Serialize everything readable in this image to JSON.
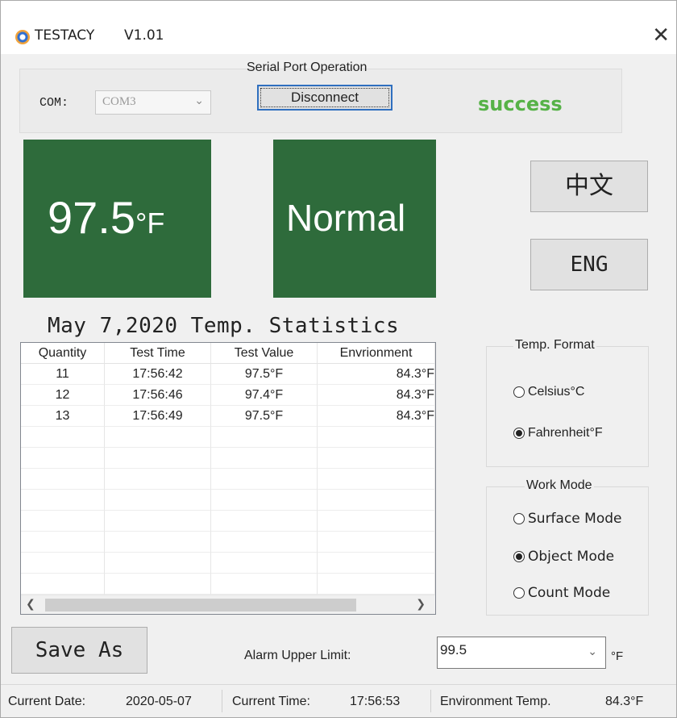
{
  "window": {
    "app_name": "TESTACY",
    "version": "V1.01",
    "close_glyph": "✕"
  },
  "serial": {
    "group_label": "Serial Port Operation",
    "com_label": "COM:",
    "com_value": "COM3",
    "disconnect_label": "Disconnect",
    "status_text": "success"
  },
  "readout": {
    "temperature": "97.5",
    "unit": "°F",
    "status": "Normal"
  },
  "language": {
    "chinese_label": "中文",
    "english_label": "ENG"
  },
  "stats": {
    "title": "May 7,2020 Temp. Statistics",
    "columns": [
      "Quantity",
      "Test Time",
      "Test Value",
      "Envrionment"
    ],
    "rows": [
      [
        "11",
        "17:56:42",
        "97.5°F",
        "84.3°F"
      ],
      [
        "12",
        "17:56:46",
        "97.4°F",
        "84.3°F"
      ],
      [
        "13",
        "17:56:49",
        "97.5°F",
        "84.3°F"
      ]
    ]
  },
  "temp_format": {
    "group_label": "Temp. Format",
    "options": [
      {
        "label": "Celsius°C",
        "selected": false
      },
      {
        "label": "Fahrenheit°F",
        "selected": true
      }
    ]
  },
  "work_mode": {
    "group_label": "Work Mode",
    "options": [
      {
        "label": "Surface Mode",
        "selected": false
      },
      {
        "label": "Object Mode",
        "selected": true
      },
      {
        "label": "Count Mode",
        "selected": false
      }
    ]
  },
  "actions": {
    "save_label": "Save As"
  },
  "alarm": {
    "label": "Alarm Upper Limit:",
    "value": "99.5",
    "unit": "°F"
  },
  "statusbar": {
    "date_label": "Current Date:",
    "date_value": "2020-05-07",
    "time_label": "Current Time:",
    "time_value": "17:56:53",
    "env_label": "Environment Temp.",
    "env_value": "84.3°F"
  },
  "colors": {
    "panel_green": "#2e6b3b",
    "success_green": "#56b247",
    "focus_blue": "#2f6fbf"
  },
  "icons": {
    "app": "testacy-logo-icon",
    "close": "close-icon",
    "dropdown": "chevron-down-icon"
  }
}
